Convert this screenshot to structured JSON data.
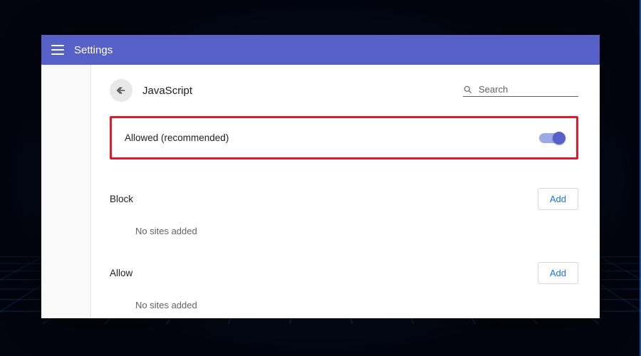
{
  "topbar": {
    "title": "Settings"
  },
  "page": {
    "title": "JavaScript",
    "search_placeholder": "Search"
  },
  "main_toggle": {
    "label": "Allowed (recommended)",
    "on": true
  },
  "sections": {
    "block": {
      "title": "Block",
      "add_label": "Add",
      "empty": "No sites added"
    },
    "allow": {
      "title": "Allow",
      "add_label": "Add",
      "empty": "No sites added"
    }
  },
  "colors": {
    "accent": "#5660c6",
    "highlight": "#e0192c",
    "link": "#1a73e8"
  }
}
